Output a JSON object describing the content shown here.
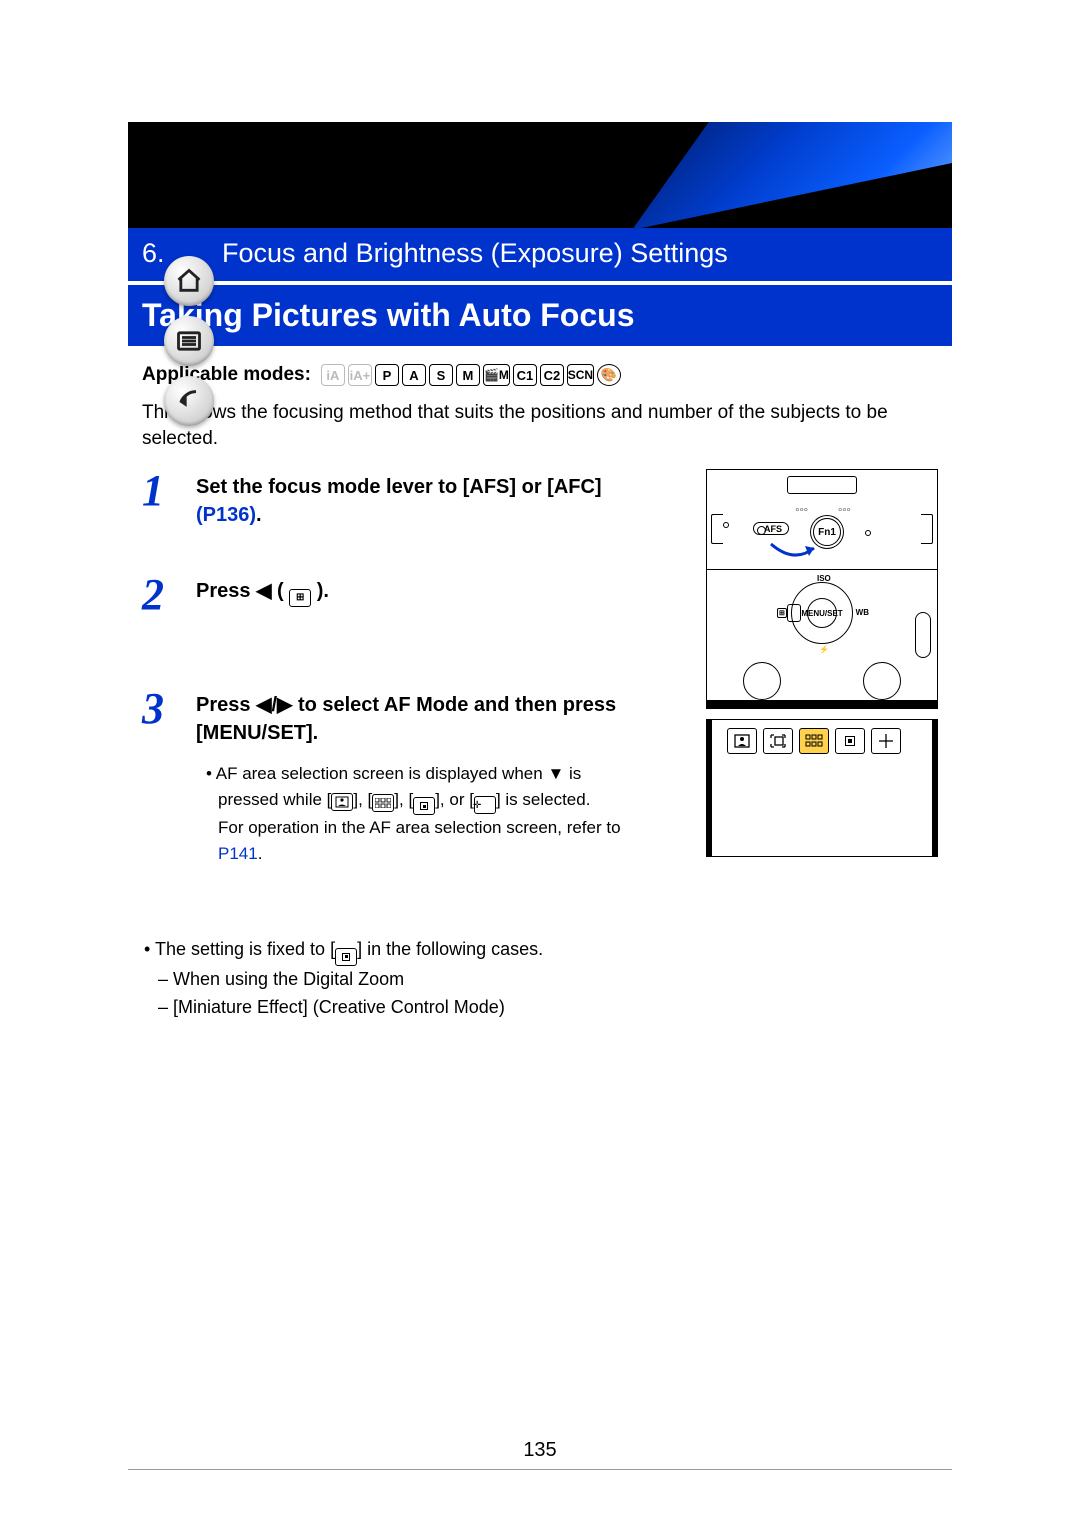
{
  "chapter": {
    "number": "6.",
    "title": "Focus and Brightness (Exposure) Settings"
  },
  "section_title": "Taking Pictures with Auto Focus",
  "applicable_label": "Applicable modes:",
  "mode_icons": [
    "iA",
    "iA+",
    "P",
    "A",
    "S",
    "M",
    "🎬M",
    "C1",
    "C2",
    "SCN",
    "🎨"
  ],
  "description": "This allows the focusing method that suits the positions and number of the subjects to be selected.",
  "steps": [
    {
      "num": "1",
      "text_pre": "Set the focus mode lever to [AFS] or [AFC] ",
      "link": "(P136)",
      "text_post": "."
    },
    {
      "num": "2",
      "text_pre": "Press ",
      "glyph_between": "◀ ( ",
      "icon_label": "⊞",
      "text_post": " )."
    },
    {
      "num": "3",
      "text_pre": "Press ",
      "glyph_lr": "◀/▶",
      "text_mid": " to select AF Mode and then press [MENU/SET].",
      "bullets": {
        "line1_pre": "AF area selection screen is displayed when ",
        "line1_post": " is pressed while [",
        "icon1": "face",
        "sep1": "], [",
        "icon2": "multi",
        "sep2": "], [",
        "icon3": "single",
        "sep3": "], or [",
        "icon4": "pinpoint",
        "line1_end": "] is selected.",
        "line2_pre": "For operation in the AF area selection screen, refer to ",
        "link2": "P141",
        "line2_post": "."
      }
    }
  ],
  "fixed_notes": {
    "line1_pre": "The setting is fixed to [",
    "icon": "single",
    "line1_post": "] in the following cases.",
    "sub1": "When using the Digital Zoom",
    "sub2": "[Miniature Effect] (Creative Control Mode)"
  },
  "illus": {
    "lever_label": "AFS",
    "fn_label": "Fn1",
    "dial_center": "MENU/SET",
    "dial_top": "ISO",
    "dial_right": "WB",
    "dial_bottom": "⚡",
    "af_modes": [
      "👤",
      "🔲",
      "▦",
      "▫",
      "✛"
    ]
  },
  "page_number": "135",
  "nav": {
    "home": "home-icon",
    "toc": "list-icon",
    "back": "back-icon"
  }
}
